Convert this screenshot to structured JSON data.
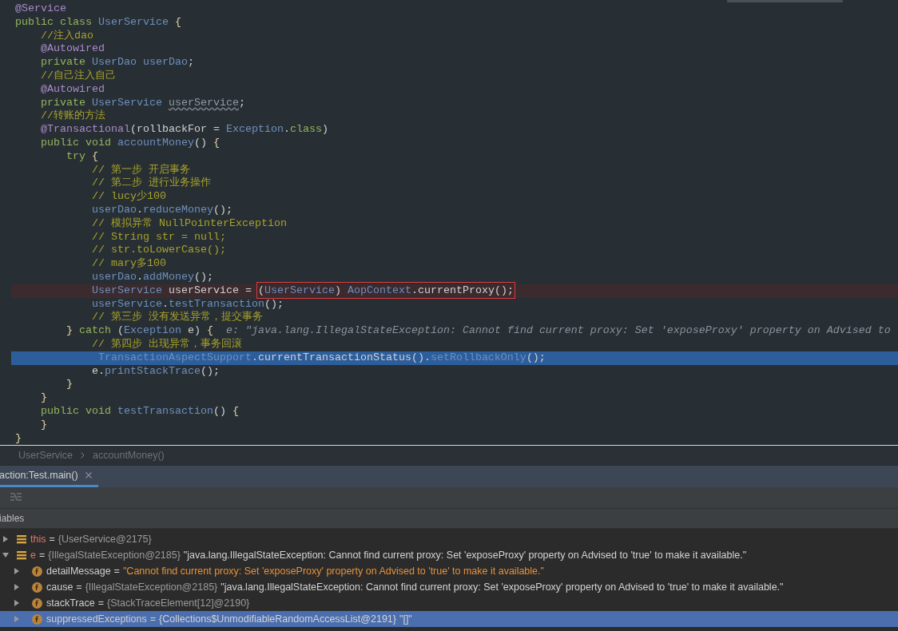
{
  "editor": {
    "lines": [
      {
        "error": false,
        "current": false,
        "tokens": [
          {
            "kind": "ann",
            "text": "@Service"
          }
        ]
      },
      {
        "error": false,
        "current": false,
        "tokens": [
          {
            "kind": "kw",
            "text": "public class "
          },
          {
            "kind": "type",
            "text": "UserService "
          },
          {
            "kind": "brace",
            "text": "{"
          }
        ]
      },
      {
        "error": false,
        "current": false,
        "tokens": [
          {
            "kind": "com",
            "text": "    //注入dao"
          }
        ]
      },
      {
        "error": false,
        "current": false,
        "tokens": [
          {
            "kind": "ann",
            "text": "    @Autowired"
          }
        ]
      },
      {
        "error": false,
        "current": false,
        "tokens": [
          {
            "kind": "kw",
            "text": "    private "
          },
          {
            "kind": "type",
            "text": "UserDao "
          },
          {
            "kind": "ident",
            "text": "userDao"
          },
          {
            "kind": "plain",
            "text": ";"
          }
        ]
      },
      {
        "error": false,
        "current": false,
        "tokens": [
          {
            "kind": "com",
            "text": "    //自己注入自己"
          }
        ]
      },
      {
        "error": false,
        "current": false,
        "tokens": [
          {
            "kind": "ann",
            "text": "    @Autowired"
          }
        ]
      },
      {
        "error": false,
        "current": false,
        "tokens": [
          {
            "kind": "kw",
            "text": "    private "
          },
          {
            "kind": "type",
            "text": "UserService "
          },
          {
            "kind": "ident",
            "text": "userService",
            "warning": true
          },
          {
            "kind": "plain",
            "text": ";"
          }
        ]
      },
      {
        "error": false,
        "current": false,
        "tokens": [
          {
            "kind": "com",
            "text": "    //转账的方法"
          }
        ]
      },
      {
        "error": false,
        "current": false,
        "tokens": [
          {
            "kind": "ann",
            "text": "    @Transactional"
          },
          {
            "kind": "plain",
            "text": "(rollbackFor = "
          },
          {
            "kind": "type",
            "text": "Exception"
          },
          {
            "kind": "plain",
            "text": "."
          },
          {
            "kind": "kw",
            "text": "class"
          },
          {
            "kind": "plain",
            "text": ")"
          }
        ]
      },
      {
        "error": false,
        "current": false,
        "tokens": [
          {
            "kind": "kw",
            "text": "    public void "
          },
          {
            "kind": "ident",
            "text": "accountMoney"
          },
          {
            "kind": "plain",
            "text": "() "
          },
          {
            "kind": "brace",
            "text": "{"
          }
        ]
      },
      {
        "error": false,
        "current": false,
        "tokens": [
          {
            "kind": "kw",
            "text": "        try "
          },
          {
            "kind": "brace",
            "text": "{"
          }
        ]
      },
      {
        "error": false,
        "current": false,
        "tokens": [
          {
            "kind": "com",
            "text": "            // 第一步 开启事务"
          }
        ]
      },
      {
        "error": false,
        "current": false,
        "tokens": [
          {
            "kind": "com",
            "text": "            // 第二步 进行业务操作"
          }
        ]
      },
      {
        "error": false,
        "current": false,
        "tokens": [
          {
            "kind": "com",
            "text": "            // lucy少100"
          }
        ]
      },
      {
        "error": false,
        "current": false,
        "tokens": [
          {
            "kind": "ident",
            "text": "            userDao"
          },
          {
            "kind": "plain",
            "text": "."
          },
          {
            "kind": "ident",
            "text": "reduceMoney"
          },
          {
            "kind": "plain",
            "text": "();"
          }
        ]
      },
      {
        "error": false,
        "current": false,
        "tokens": [
          {
            "kind": "com",
            "text": "            // 模拟异常 NullPointerException"
          }
        ]
      },
      {
        "error": false,
        "current": false,
        "tokens": [
          {
            "kind": "com",
            "text": "            // String str = null;"
          }
        ]
      },
      {
        "error": false,
        "current": false,
        "tokens": [
          {
            "kind": "com",
            "text": "            // str.toLowerCase();"
          }
        ]
      },
      {
        "error": false,
        "current": false,
        "tokens": [
          {
            "kind": "com",
            "text": "            // mary多100"
          }
        ]
      },
      {
        "error": false,
        "current": false,
        "tokens": [
          {
            "kind": "ident",
            "text": "            userDao"
          },
          {
            "kind": "plain",
            "text": "."
          },
          {
            "kind": "ident",
            "text": "addMoney"
          },
          {
            "kind": "plain",
            "text": "();"
          }
        ]
      },
      {
        "error": true,
        "current": false,
        "tokens": [
          {
            "kind": "type",
            "text": "            UserService "
          },
          {
            "kind": "plain",
            "text": "userService = "
          }
        ],
        "box": {
          "tokens": [
            {
              "kind": "plain",
              "text": "("
            },
            {
              "kind": "type",
              "text": "UserService"
            },
            {
              "kind": "plain",
              "text": ") "
            },
            {
              "kind": "type",
              "text": "AopContext"
            },
            {
              "kind": "plain",
              "text": ".currentProxy();"
            }
          ]
        }
      },
      {
        "error": false,
        "current": false,
        "tokens": [
          {
            "kind": "ident",
            "text": "            userService"
          },
          {
            "kind": "plain",
            "text": "."
          },
          {
            "kind": "ident",
            "text": "testTransaction"
          },
          {
            "kind": "plain",
            "text": "();"
          }
        ]
      },
      {
        "error": false,
        "current": false,
        "tokens": [
          {
            "kind": "com",
            "text": "            // 第三步 没有发送异常，提交事务"
          }
        ]
      },
      {
        "error": false,
        "current": false,
        "tokens": [
          {
            "kind": "brace",
            "text": "        } "
          },
          {
            "kind": "kw",
            "text": "catch "
          },
          {
            "kind": "plain",
            "text": "("
          },
          {
            "kind": "type",
            "text": "Exception "
          },
          {
            "kind": "plain",
            "text": "e) "
          },
          {
            "kind": "brace",
            "text": "{"
          },
          {
            "kind": "inline",
            "text": "  e: \"java.lang.IllegalStateException: Cannot find current proxy: Set 'exposeProxy' property on Advised to"
          }
        ]
      },
      {
        "error": false,
        "current": false,
        "tokens": [
          {
            "kind": "com",
            "text": "            // 第四步 出现异常，事务回滚"
          }
        ]
      },
      {
        "error": false,
        "current": true,
        "tokens": [
          {
            "kind": "type",
            "text": "             TransactionAspectSupport"
          },
          {
            "kind": "plain",
            "text": ".currentTransactionStatus()."
          },
          {
            "kind": "ident",
            "text": "setRollbackOnly"
          },
          {
            "kind": "plain",
            "text": "();"
          }
        ]
      },
      {
        "error": false,
        "current": false,
        "tokens": [
          {
            "kind": "plain",
            "text": "            e."
          },
          {
            "kind": "ident",
            "text": "printStackTrace"
          },
          {
            "kind": "plain",
            "text": "();"
          }
        ]
      },
      {
        "error": false,
        "current": false,
        "tokens": [
          {
            "kind": "brace",
            "text": "        }"
          }
        ]
      },
      {
        "error": false,
        "current": false,
        "tokens": [
          {
            "kind": "brace",
            "text": "    }"
          }
        ]
      },
      {
        "error": false,
        "current": false,
        "tokens": [
          {
            "kind": "kw",
            "text": "    public void "
          },
          {
            "kind": "ident",
            "text": "testTransaction"
          },
          {
            "kind": "plain",
            "text": "() "
          },
          {
            "kind": "brace",
            "text": "{"
          }
        ]
      },
      {
        "error": false,
        "current": false,
        "tokens": [
          {
            "kind": "brace",
            "text": "    }"
          }
        ]
      },
      {
        "error": false,
        "current": false,
        "tokens": [
          {
            "kind": "brace",
            "text": "}"
          }
        ]
      }
    ]
  },
  "breadcrumb": [
    "UserService",
    "accountMoney()"
  ],
  "debug_tabs": [
    {
      "label": "action:Test.main()",
      "selected": true
    }
  ],
  "variables_panel": {
    "title": "iables",
    "rows": [
      {
        "kind": "local",
        "name": "this",
        "op": "=",
        "expanded": false,
        "selected": false,
        "value": [
          {
            "kind": "ref",
            "text": "{UserService@2175}"
          }
        ]
      },
      {
        "kind": "local",
        "name": "e",
        "op": "=",
        "expanded": true,
        "selected": false,
        "value": [
          {
            "kind": "ref",
            "text": "{IllegalStateException@2185}"
          },
          {
            "kind": "text",
            "text": "\"java.lang.IllegalStateException: Cannot find current proxy: Set 'exposeProxy' property on Advised to 'true' to make it available.\""
          }
        ],
        "children": [
          {
            "kind": "field",
            "name": "detailMessage",
            "op": "=",
            "expanded": false,
            "selected": false,
            "value": [
              {
                "kind": "string",
                "text": "\"Cannot find current proxy: Set 'exposeProxy' property on Advised to 'true' to make it available.\""
              }
            ]
          },
          {
            "kind": "field",
            "name": "cause",
            "op": "=",
            "expanded": false,
            "selected": false,
            "value": [
              {
                "kind": "ref",
                "text": "{IllegalStateException@2185}"
              },
              {
                "kind": "text",
                "text": "\"java.lang.IllegalStateException: Cannot find current proxy: Set 'exposeProxy' property on Advised to 'true' to make it available.\""
              }
            ]
          },
          {
            "kind": "field",
            "name": "stackTrace",
            "op": "=",
            "expanded": false,
            "selected": false,
            "value": [
              {
                "kind": "ref",
                "text": "{StackTraceElement[12]@2190}"
              }
            ]
          },
          {
            "kind": "field",
            "name": "suppressedExceptions",
            "op": "=",
            "expanded": false,
            "selected": true,
            "value": [
              {
                "kind": "text",
                "text": "{Collections$UnmodifiableRandomAccessList@2191}"
              },
              {
                "kind": "text",
                "text": "\"[]\""
              }
            ]
          }
        ]
      }
    ]
  }
}
